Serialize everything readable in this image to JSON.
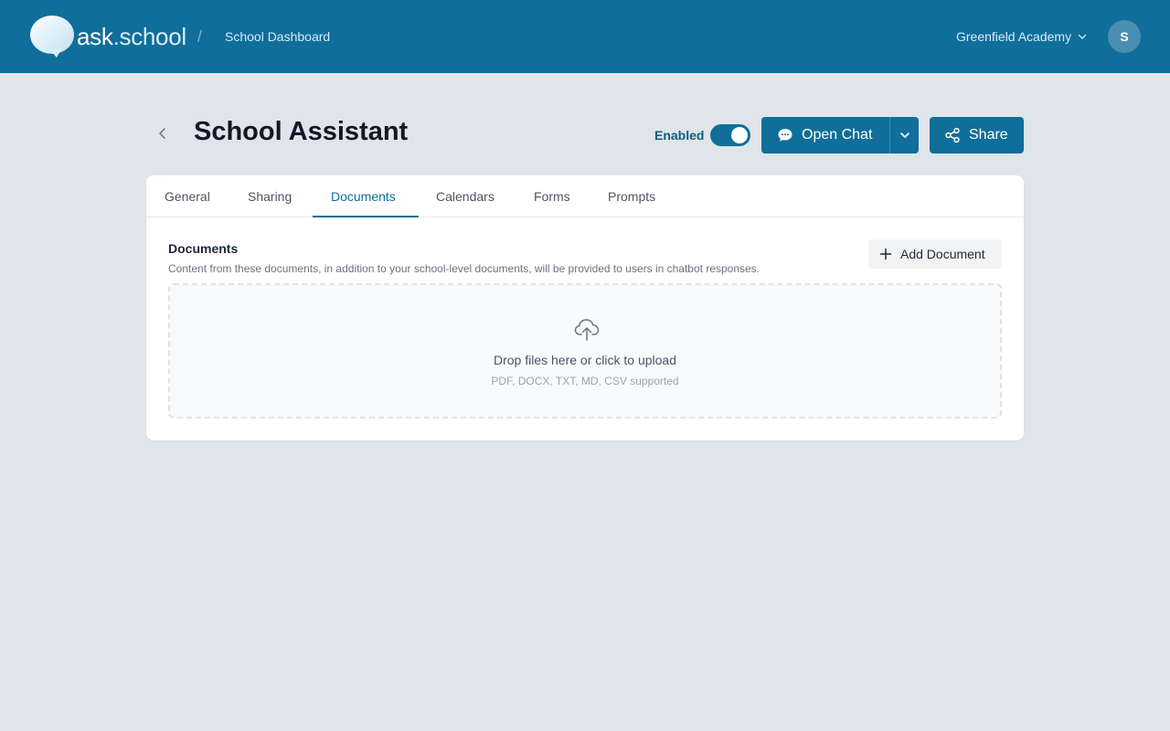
{
  "header": {
    "brand_prefix": "ask",
    "brand_dot": ".",
    "brand_suffix": "school",
    "breadcrumb_separator": "/",
    "breadcrumb": "School Dashboard",
    "organization": "Greenfield Academy",
    "avatar_initial": "S"
  },
  "page": {
    "title": "School Assistant",
    "enabled_label": "Enabled",
    "enabled": true,
    "open_chat_label": "Open Chat",
    "share_label": "Share"
  },
  "tabs": [
    {
      "label": "General",
      "active": false
    },
    {
      "label": "Sharing",
      "active": false
    },
    {
      "label": "Documents",
      "active": true
    },
    {
      "label": "Calendars",
      "active": false
    },
    {
      "label": "Forms",
      "active": false
    },
    {
      "label": "Prompts",
      "active": false
    }
  ],
  "documents": {
    "title": "Documents",
    "description": "Content from these documents, in addition to your school-level documents, will be provided to users in chatbot responses.",
    "add_label": "Add Document",
    "dropzone_text": "Drop files here or click to upload",
    "dropzone_hint": "PDF, DOCX, TXT, MD, CSV supported"
  },
  "colors": {
    "primary": "#0f6e9a",
    "background": "#dfe5e9",
    "card": "#ffffff"
  },
  "icons": [
    "chat-bubble-logo-icon",
    "chevron-down-icon",
    "chevron-left-icon",
    "chat-icon",
    "share-icon",
    "plus-icon",
    "cloud-upload-icon"
  ]
}
